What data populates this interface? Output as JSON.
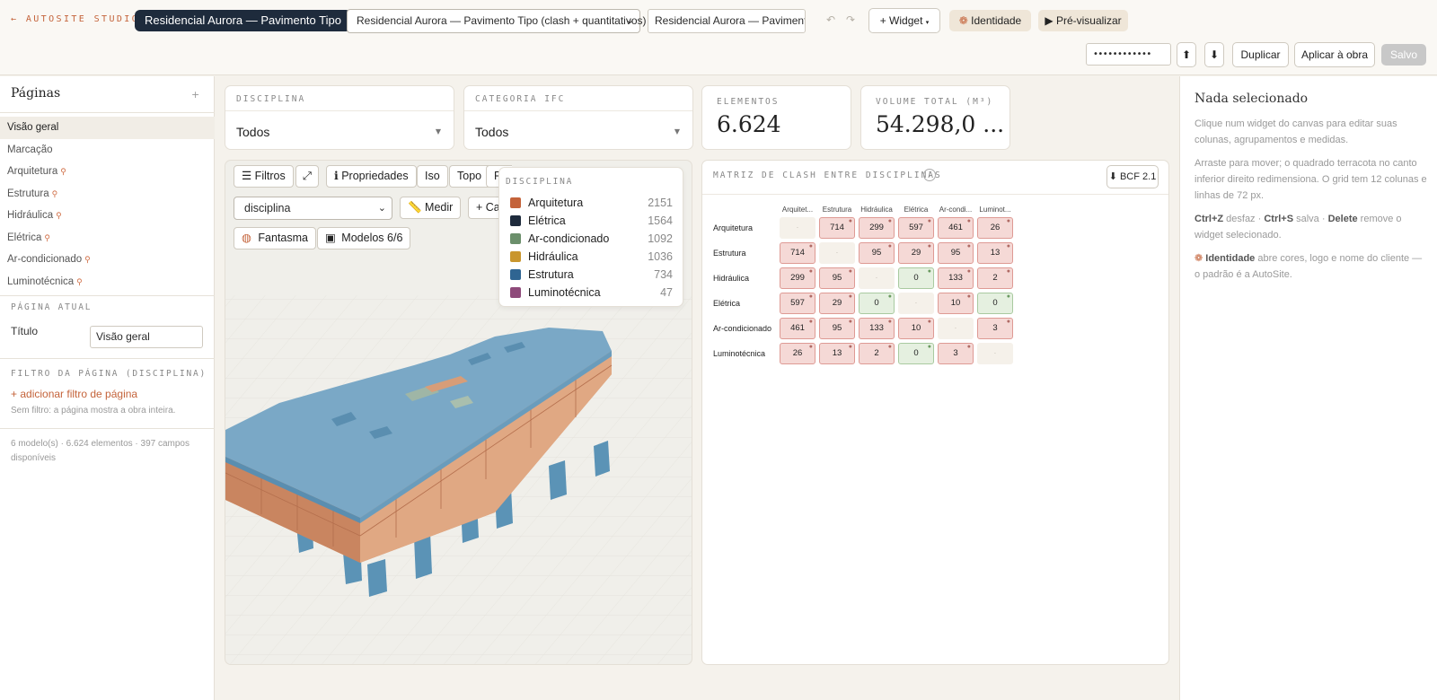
{
  "header": {
    "brand": "← AUTOSITE STUDIO",
    "project_pill": "Residencial Aurora — Pavimento Tipo",
    "dashboard_select": "Residencial Aurora — Pavimento Tipo (clash + quantitativos)",
    "dashboard_name": "Residencial Aurora — Pavimento",
    "undo_icon": "↶",
    "redo_icon": "↷",
    "widget_button": "+ Widget",
    "identity_button": "Identidade",
    "preview_button": "▶ Pré-visualizar",
    "password_value": "••••••••••••",
    "upload_icon": "⬆",
    "download_icon": "⬇",
    "duplicate_button": "Duplicar",
    "apply_button": "Aplicar à obra",
    "saved_button": "Salvo"
  },
  "sidebar": {
    "title": "Páginas",
    "add": "+",
    "pages": [
      {
        "label": "Visão geral",
        "pin": ""
      },
      {
        "label": "Marcação",
        "pin": ""
      },
      {
        "label": "Arquitetura",
        "pin": "⚲"
      },
      {
        "label": "Estrutura",
        "pin": "⚲"
      },
      {
        "label": "Hidráulica",
        "pin": "⚲"
      },
      {
        "label": "Elétrica",
        "pin": "⚲"
      },
      {
        "label": "Ar-condicionado",
        "pin": "⚲"
      },
      {
        "label": "Luminotécnica",
        "pin": "⚲"
      }
    ],
    "current_page_label": "PÁGINA ATUAL",
    "title_label": "Título",
    "title_value": "Visão geral",
    "filter_label": "FILTRO DA PÁGINA (DISCIPLINA)",
    "add_filter": "+ adicionar filtro de página",
    "no_filter": "Sem filtro: a página mostra a obra inteira.",
    "meta": "6 modelo(s) · 6.624 elementos · 397 campos disponíveis"
  },
  "filters": {
    "discipline": {
      "label": "DISCIPLINA",
      "value": "Todos"
    },
    "ifc_category": {
      "label": "CATEGORIA IFC",
      "value": "Todos"
    }
  },
  "kpis": {
    "elements": {
      "label": "ELEMENTOS",
      "value": "6.624"
    },
    "volume": {
      "label": "VOLUME TOTAL (M³)",
      "value": "54.298,0 ..."
    }
  },
  "viewer": {
    "filters_btn": "☰ Filtros",
    "expand_btn": "⤢",
    "props_btn": "ℹ Propriedades",
    "iso_btn": "Iso",
    "top_btn": "Topo",
    "front_btn": "Fr",
    "color_by": "disciplina",
    "measure_btn": "📏 Medir",
    "capture_btn": "+ Ca",
    "ghost_btn": "Fantasma",
    "models_btn": "Modelos 6/6",
    "legend_title": "DISCIPLINA",
    "legend": [
      {
        "name": "Arquitetura",
        "count": "2151",
        "color": "#c4633a"
      },
      {
        "name": "Elétrica",
        "count": "1564",
        "color": "#1e2b3c"
      },
      {
        "name": "Ar-condicionado",
        "count": "1092",
        "color": "#6b8f6b"
      },
      {
        "name": "Hidráulica",
        "count": "1036",
        "color": "#c9962e"
      },
      {
        "name": "Estrutura",
        "count": "734",
        "color": "#2f6592"
      },
      {
        "name": "Luminotécnica",
        "count": "47",
        "color": "#8e4a7a"
      }
    ]
  },
  "matrix": {
    "title": "MATRIZ DE CLASH ENTRE DISCIPLINAS",
    "info_icon": "i",
    "bcf_button": "⬇ BCF 2.1",
    "columns": [
      "Arquitet...",
      "Estrutura",
      "Hidráulica",
      "Elétrica",
      "Ar-condi...",
      "Luminot..."
    ],
    "rows": [
      "Arquitetura",
      "Estrutura",
      "Hidráulica",
      "Elétrica",
      "Ar-condicionado",
      "Luminotécnica"
    ],
    "cells": [
      [
        "·",
        "714",
        "299",
        "597",
        "461",
        "26"
      ],
      [
        "714",
        "·",
        "95",
        "29",
        "95",
        "13"
      ],
      [
        "299",
        "95",
        "·",
        "0",
        "133",
        "2"
      ],
      [
        "597",
        "29",
        "0",
        "·",
        "10",
        "0"
      ],
      [
        "461",
        "95",
        "133",
        "10",
        "·",
        "3"
      ],
      [
        "26",
        "13",
        "2",
        "0",
        "3",
        "·"
      ]
    ]
  },
  "right_panel": {
    "title": "Nada selecionado",
    "p1": "Clique num widget do canvas para editar suas colunas, agrupamentos e medidas.",
    "p2": "Arraste para mover; o quadrado terracota no canto inferior direito redimensiona. O grid tem 12 colunas e linhas de 72 px.",
    "k_undo": "Ctrl+Z",
    "t_undo": " desfaz · ",
    "k_save": "Ctrl+S",
    "t_save": " salva · ",
    "k_del": "Delete",
    "t_del": " remove o widget selecionado.",
    "k_ident": "Identidade",
    "t_ident": " abre cores, logo e nome do cliente — o padrão é a AutoSite."
  }
}
